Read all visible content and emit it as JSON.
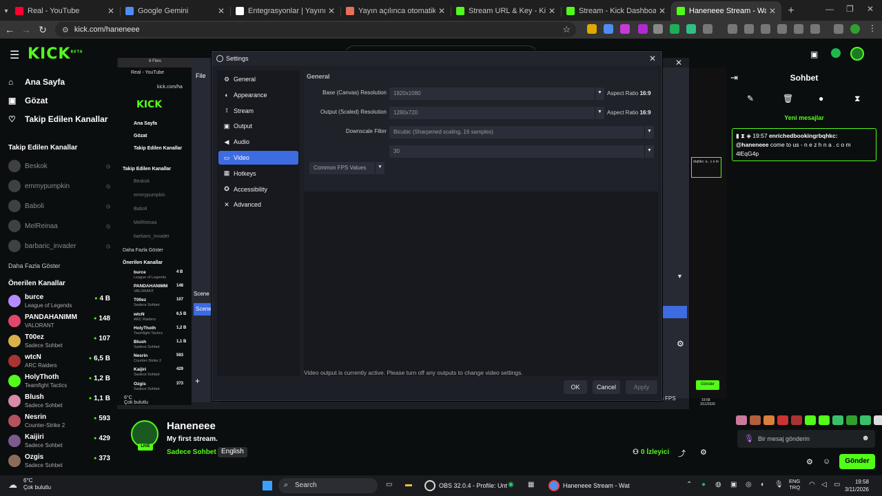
{
  "browser": {
    "tabs": [
      {
        "title": "Real - YouTube",
        "color": "#ff0033"
      },
      {
        "title": "Google Gemini",
        "color": "#4f8df5"
      },
      {
        "title": "Entegrasyonlar | Yayınını güçle",
        "color": "#ffffff"
      },
      {
        "title": "Yayın açılınca otomatik duyuru",
        "color": "#e8705a"
      },
      {
        "title": "Stream URL & Key - Kick Dashb",
        "color": "#53fc18"
      },
      {
        "title": "Stream - Kick Dashboard",
        "color": "#53fc18"
      },
      {
        "title": "Haneneee Stream - Watch Live",
        "color": "#53fc18"
      }
    ],
    "url": "kick.com/haneneee"
  },
  "kick": {
    "logo": "KICK",
    "logo_sup": "BETA",
    "nav": [
      {
        "label": "Ana Sayfa",
        "icon": "home-icon"
      },
      {
        "label": "Gözat",
        "icon": "browse-icon"
      },
      {
        "label": "Takip Edilen Kanallar",
        "icon": "heart-icon"
      }
    ],
    "followed_heading": "Takip Edilen Kanallar",
    "followed": [
      "Beskok",
      "emmypumpkin",
      "Baboli",
      "MelReinaa",
      "barbaric_invader"
    ],
    "show_more": "Daha Fazla Göster",
    "recommended_heading": "Önerilen Kanallar",
    "recommended": [
      {
        "name": "burce",
        "category": "League of Legends",
        "viewers": "4 B",
        "color": "#b58cff"
      },
      {
        "name": "PANDAHANIMM",
        "category": "VALORANT",
        "viewers": "148",
        "color": "#e0476b"
      },
      {
        "name": "T00ez",
        "category": "Sadece Sohbet",
        "viewers": "107",
        "color": "#d8b14a"
      },
      {
        "name": "wtcN",
        "category": "ARC Raiders",
        "viewers": "6,5 B",
        "color": "#a33"
      },
      {
        "name": "HolyThoth",
        "category": "Teamfight Tactics",
        "viewers": "1,2 B",
        "color": "#53fc18"
      },
      {
        "name": "Blush",
        "category": "Sadece Sohbet",
        "viewers": "1,1 B",
        "color": "#d98aa8"
      },
      {
        "name": "Nesrin",
        "category": "Counter-Strike 2",
        "viewers": "593",
        "color": "#b4525e"
      },
      {
        "name": "Kaijiri",
        "category": "Sadece Sohbet",
        "viewers": "429",
        "color": "#7a5b8c"
      },
      {
        "name": "Ozgis",
        "category": "Sadece Sohbet",
        "viewers": "373",
        "color": "#8c6b5a"
      }
    ]
  },
  "nested": {
    "tab_count": "6 Files",
    "tab_title": "Real - YouTube",
    "url": "kick.com/ha",
    "logo": "KICK",
    "nav": [
      "Ana Sayfa",
      "Gözat",
      "Takip Edilen Kanallar"
    ],
    "followed_heading": "Takip Edilen Kanallar",
    "followed": [
      "Beskok",
      "emmypumpkin",
      "Baboli",
      "MelReinaa",
      "barbaric_invader"
    ],
    "show_more": "Daha Fazla Göster",
    "recommended_heading": "Önerilen Kanallar",
    "recommended": [
      {
        "name": "burce",
        "category": "League of Legends",
        "viewers": "4 B"
      },
      {
        "name": "PANDAHANIMM",
        "category": "VALORANT",
        "viewers": "148"
      },
      {
        "name": "T00ez",
        "category": "Sadece Sohbet",
        "viewers": "107"
      },
      {
        "name": "wtcN",
        "category": "ARC Raiders",
        "viewers": "6,5 B"
      },
      {
        "name": "HolyThoth",
        "category": "Teamfight Tactics",
        "viewers": "1,2 B"
      },
      {
        "name": "Blush",
        "category": "Sadece Sohbet",
        "viewers": "1,1 B"
      },
      {
        "name": "Nesrin",
        "category": "Counter-Strike 2",
        "viewers": "593"
      },
      {
        "name": "Kaijiri",
        "category": "Sadece Sohbet",
        "viewers": "429"
      },
      {
        "name": "Ozgis",
        "category": "Sadece Sohbet",
        "viewers": "373"
      }
    ],
    "obs_menu": "File",
    "scenes_label": "Scene",
    "scene_item": "Scene",
    "fps": "15 FPS",
    "weather": "6°C",
    "weather_desc": "Çok bulutlu",
    "time": "19:58",
    "date": "3/11/2026"
  },
  "settings": {
    "title": "Settings",
    "nav": [
      {
        "label": "General",
        "icon": "gear-icon"
      },
      {
        "label": "Appearance",
        "icon": "palette-icon"
      },
      {
        "label": "Stream",
        "icon": "antenna-icon"
      },
      {
        "label": "Output",
        "icon": "output-icon"
      },
      {
        "label": "Audio",
        "icon": "speaker-icon"
      },
      {
        "label": "Video",
        "icon": "monitor-icon"
      },
      {
        "label": "Hotkeys",
        "icon": "keyboard-icon"
      },
      {
        "label": "Accessibility",
        "icon": "accessibility-icon"
      },
      {
        "label": "Advanced",
        "icon": "wrench-icon"
      }
    ],
    "selected": "Video",
    "section": "General",
    "base_label": "Base (Canvas) Resolution",
    "base_value": "1920x1080",
    "base_aspect_label": "Aspect Ratio",
    "base_aspect": "16:9",
    "output_label": "Output (Scaled) Resolution",
    "output_value": "1280x720",
    "output_aspect_label": "Aspect Ratio",
    "output_aspect": "16:9",
    "downscale_label": "Downscale Filter",
    "downscale_value": "Bicubic (Sharpened scaling, 16 samples)",
    "fps_type": "Common FPS Values",
    "fps_value": "30",
    "warning": "Video output is currently active. Please turn off any outputs to change video settings.",
    "ok": "OK",
    "cancel": "Cancel",
    "apply": "Apply"
  },
  "chat": {
    "title": "Sohbet",
    "new_messages": "Yeni mesajlar",
    "pinned_time": "19:57",
    "pinned_user": "enrichedbookingrbqhkc:",
    "pinned_mention": "@haneneee",
    "pinned_text": "come to us - n e z h n a . c o m 4lEqG4p",
    "input_placeholder": "Bir mesaj gönderin",
    "send": "Gönder",
    "nested_send": "Gönder",
    "nested_pinned": "rbqhkc: a . c o m"
  },
  "stream": {
    "name": "Haneneee",
    "title": "My first stream.",
    "category": "Sadece Sohbet",
    "language": "English",
    "live": "LIVE",
    "viewers": "0",
    "viewers_label": "İzleyici"
  },
  "taskbar": {
    "weather_temp": "6°C",
    "weather_desc": "Çok bulutlu",
    "search": "Search",
    "obs_app": "OBS 32.0.4 - Profile: Unt",
    "chrome_app": "Haneneee Stream - Wat",
    "lang_1": "ENG",
    "lang_2": "TRQ",
    "time": "19:58",
    "date": "3/11/2026"
  }
}
